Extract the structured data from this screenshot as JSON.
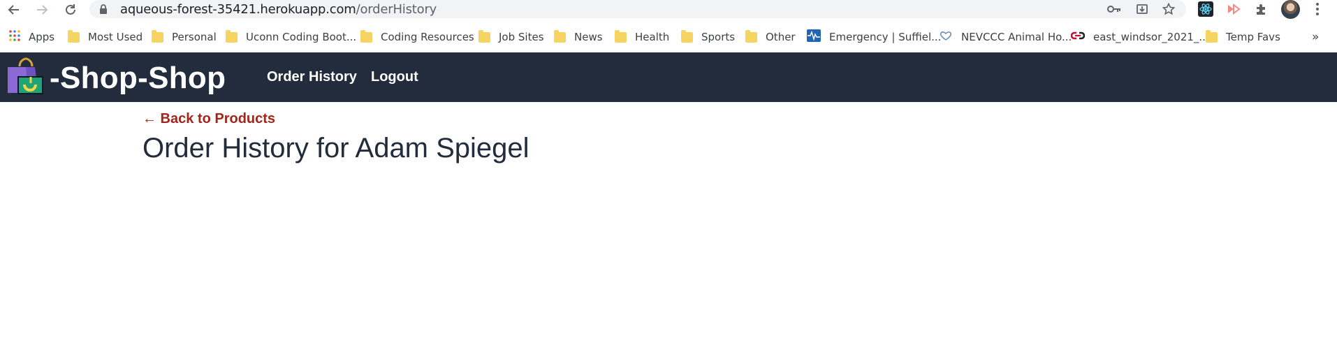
{
  "browser": {
    "url_host": "aqueous-forest-35421.herokuapp.com",
    "url_path": "/orderHistory",
    "bookmarks": [
      {
        "label": "Apps",
        "icon": "apps-grid-icon"
      },
      {
        "label": "Most Used",
        "icon": "folder-icon"
      },
      {
        "label": "Personal",
        "icon": "folder-icon"
      },
      {
        "label": "Uconn Coding Boot...",
        "icon": "folder-icon"
      },
      {
        "label": "Coding Resources",
        "icon": "folder-icon"
      },
      {
        "label": "Job Sites",
        "icon": "folder-icon"
      },
      {
        "label": "News",
        "icon": "folder-icon"
      },
      {
        "label": "Health",
        "icon": "folder-icon"
      },
      {
        "label": "Sports",
        "icon": "folder-icon"
      },
      {
        "label": "Other",
        "icon": "folder-icon"
      },
      {
        "label": "Emergency | Suffiel...",
        "icon": "waveform-icon"
      },
      {
        "label": "NEVCCC Animal Ho...",
        "icon": "heart-hands-icon"
      },
      {
        "label": "east_windsor_2021_...",
        "icon": "link-logo-icon"
      },
      {
        "label": "Temp Favs",
        "icon": "folder-icon"
      }
    ],
    "more_bookmarks": "»"
  },
  "header": {
    "brand_title": "-Shop-Shop",
    "nav": {
      "order_history": "Order History",
      "logout": "Logout"
    }
  },
  "main": {
    "back_link": "← Back to Products",
    "title": "Order History for Adam Spiegel"
  },
  "colors": {
    "header_bg": "#222c3c",
    "link_red": "#a3241a",
    "title_text": "#222c3c",
    "folder_yellow": "#f5d462"
  }
}
